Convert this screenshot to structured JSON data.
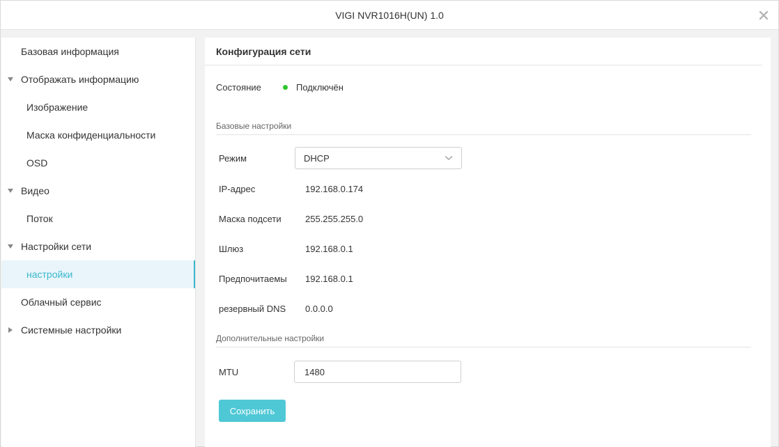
{
  "window": {
    "title": "VIGI NVR1016H(UN) 1.0"
  },
  "sidebar": {
    "items": [
      {
        "label": "Базовая информация"
      },
      {
        "label": "Отображать информацию"
      },
      {
        "label": "Изображение"
      },
      {
        "label": "Маска конфиденциальности"
      },
      {
        "label": "OSD"
      },
      {
        "label": "Видео"
      },
      {
        "label": "Поток"
      },
      {
        "label": "Настройки сети"
      },
      {
        "label": "настройки"
      },
      {
        "label": "Облачный сервис"
      },
      {
        "label": "Системные настройки"
      }
    ]
  },
  "main": {
    "header": "Конфигурация сети",
    "status": {
      "label": "Состояние",
      "value": "Подключён",
      "color": "#2ec52e"
    },
    "basic_section": "Базовые настройки",
    "mode": {
      "label": "Режим",
      "value": "DHCP"
    },
    "ip": {
      "label": "IP-адрес",
      "value": "192.168.0.174"
    },
    "mask": {
      "label": "Маска подсети",
      "value": "255.255.255.0"
    },
    "gateway": {
      "label": "Шлюз",
      "value": "192.168.0.1"
    },
    "preferred_dns": {
      "label": "Предпочитаемы",
      "value": "192.168.0.1"
    },
    "backup_dns": {
      "label": "резервный DNS",
      "value": "0.0.0.0"
    },
    "advanced_section": "Дополнительные настройки",
    "mtu": {
      "label": "MTU",
      "value": "1480"
    },
    "save_label": "Сохранить"
  },
  "colors": {
    "accent": "#3ab8cc",
    "button": "#4fc8d6",
    "active_bg": "#eaf5fb"
  },
  "icons": {
    "close": "close-icon",
    "expand": "triangle-down-icon",
    "collapse": "triangle-right-icon",
    "dropdown": "chevron-down-icon"
  }
}
